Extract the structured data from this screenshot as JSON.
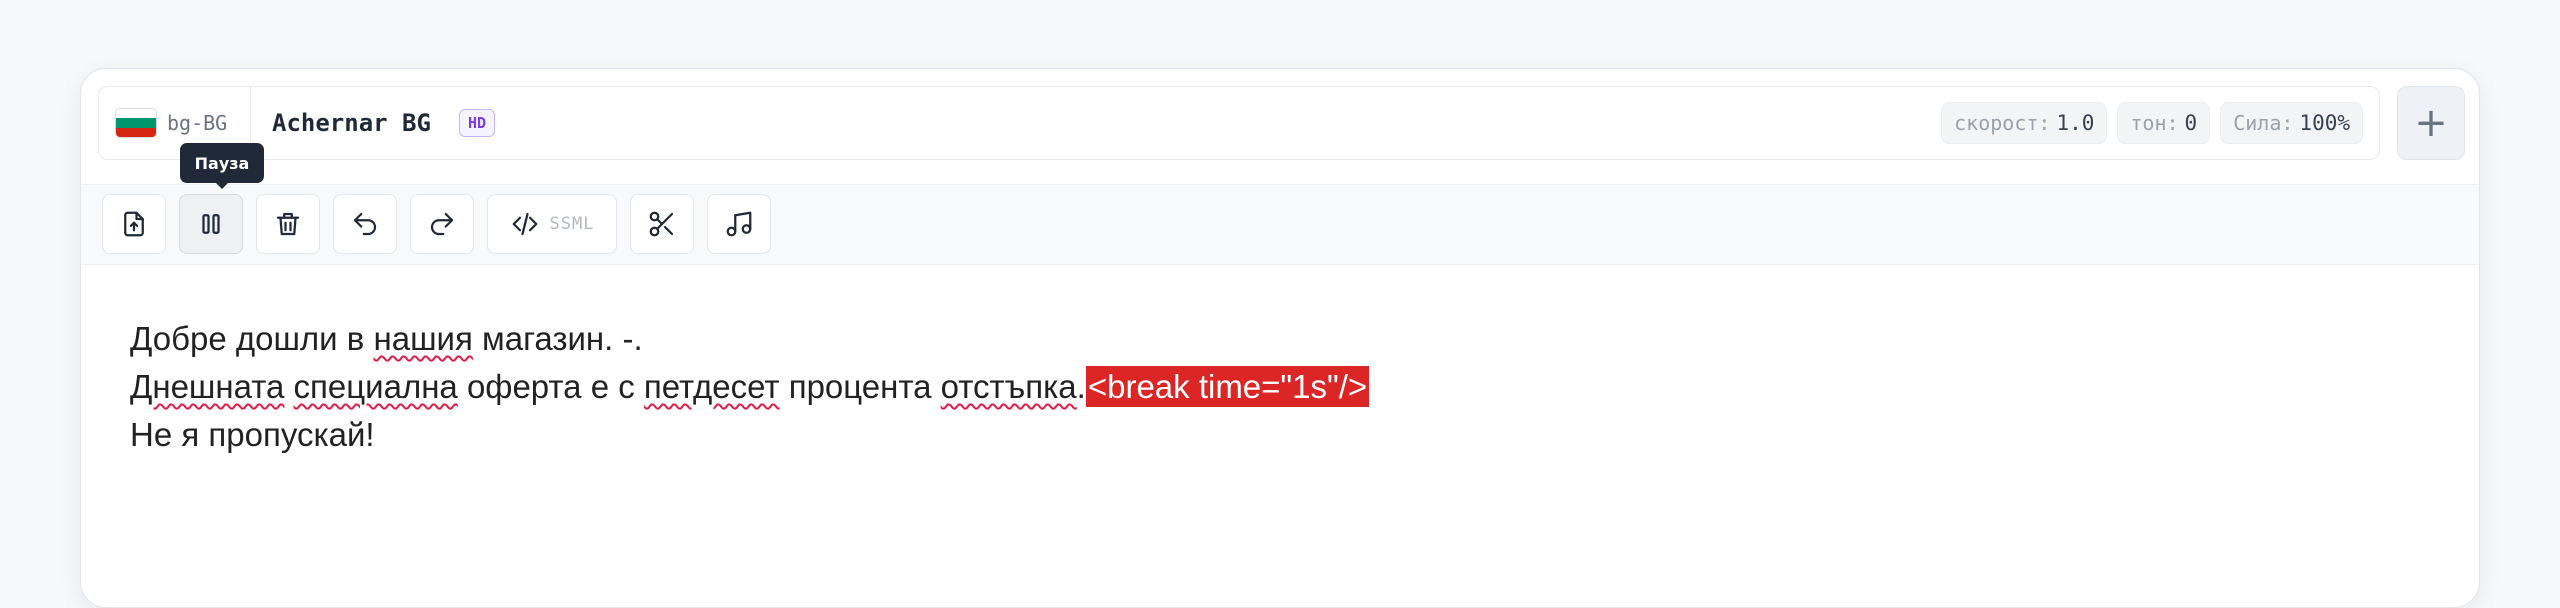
{
  "voice_bar": {
    "flag_colors": [
      "#ffffff",
      "#00966e",
      "#d62612"
    ],
    "language_code": "bg-BG",
    "voice_name": "Achernar BG",
    "quality_badge": "HD",
    "params": [
      {
        "key": "скорост:",
        "value": "1.0"
      },
      {
        "key": "тон:",
        "value": "0"
      },
      {
        "key": "Сила:",
        "value": "100%"
      }
    ],
    "add_label": "+"
  },
  "toolbar": {
    "tooltip": "Пауза",
    "ssml_label": "SSML",
    "buttons": [
      "upload-icon",
      "pause-icon",
      "trash-icon",
      "undo-icon",
      "redo-icon",
      "code-icon",
      "scissors-icon",
      "music-icon"
    ]
  },
  "editor": {
    "line1": {
      "a": "Добре дошли в ",
      "b": "нашия",
      "c": " магазин. -."
    },
    "line2": {
      "a": "Днешната",
      "b": " ",
      "c": "специална",
      "d": " оферта е с ",
      "e": "петдесет",
      "f": " процента ",
      "g": "отстъпка",
      "h": ".",
      "tag": "<break time=\"1s\"/>"
    },
    "line3": "Не я пропускай!"
  },
  "colors": {
    "ssml_highlight": "#dc2626",
    "spell_underline": "#e11d48",
    "hd_badge": "#7c3aed"
  }
}
